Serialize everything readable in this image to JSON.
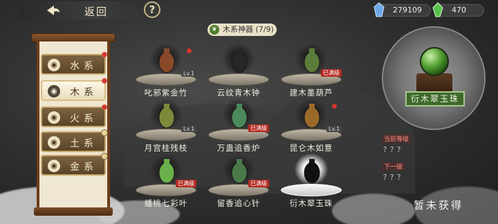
{
  "top_bar": {
    "back_label": "返回",
    "help_label": "?",
    "resources": [
      {
        "name": "crystal",
        "icon": "blue-crystal-icon",
        "value": "279109"
      },
      {
        "name": "jade",
        "icon": "green-jade-icon",
        "value": "470"
      }
    ]
  },
  "sidebar": {
    "tabs": [
      {
        "icon": "water-icon",
        "glyph": "◉",
        "label": "水系",
        "active": false,
        "marker": "red-dot"
      },
      {
        "icon": "wood-icon",
        "glyph": "◉",
        "label": "木系",
        "active": true,
        "marker": "red-dot"
      },
      {
        "icon": "fire-icon",
        "glyph": "◉",
        "label": "火系",
        "active": false,
        "marker": "red-dot"
      },
      {
        "icon": "earth-icon",
        "glyph": "◉",
        "label": "土系",
        "active": false,
        "marker": "badge"
      },
      {
        "icon": "metal-icon",
        "glyph": "◉",
        "label": "金系",
        "active": false,
        "marker": "badge"
      }
    ]
  },
  "grid": {
    "title": "木系神器 (7/9)",
    "items": [
      {
        "name": "叱邪紫金竹",
        "tag": "Lv.1",
        "tag_type": "level",
        "red_dot": true,
        "art": "bamboo-artifact-icon",
        "color": "#8a4a2a"
      },
      {
        "name": "云纹青木钟",
        "tag": "",
        "tag_type": "none",
        "red_dot": false,
        "art": "bell-artifact-icon",
        "color": "#262626"
      },
      {
        "name": "建木墨葫芦",
        "tag": "已满级",
        "tag_type": "max",
        "red_dot": false,
        "art": "gourd-artifact-icon",
        "color": "#5c7d3a"
      },
      {
        "name": "月宫桂残枝",
        "tag": "Lv.1",
        "tag_type": "level",
        "red_dot": false,
        "art": "branch-artifact-icon",
        "color": "#7c8a3a"
      },
      {
        "name": "万蛊追香炉",
        "tag": "已满级",
        "tag_type": "max",
        "red_dot": false,
        "art": "censer-artifact-icon",
        "color": "#4a8a5a"
      },
      {
        "name": "昆仑木如意",
        "tag": "Lv.1",
        "tag_type": "level",
        "red_dot": true,
        "art": "ruyi-artifact-icon",
        "color": "#9a6a2a"
      },
      {
        "name": "蟠桃七彩叶",
        "tag": "已满级",
        "tag_type": "max",
        "red_dot": false,
        "art": "leaf-artifact-icon",
        "color": "#6ab04a"
      },
      {
        "name": "留香追心针",
        "tag": "已满级",
        "tag_type": "max",
        "red_dot": false,
        "art": "needle-artifact-icon",
        "color": "#4a7a4a"
      },
      {
        "name": "衍木翠玉珠",
        "tag": "",
        "tag_type": "none",
        "red_dot": false,
        "art": "locked-silhouette-icon",
        "color": "#111111",
        "selected": true
      }
    ]
  },
  "detail": {
    "name": "衍木翠玉珠",
    "current_level_label": "当前等级",
    "current_level_value": "？？？",
    "next_level_label": "下一级",
    "next_level_value": "？？？",
    "status": "暂未获得"
  }
}
